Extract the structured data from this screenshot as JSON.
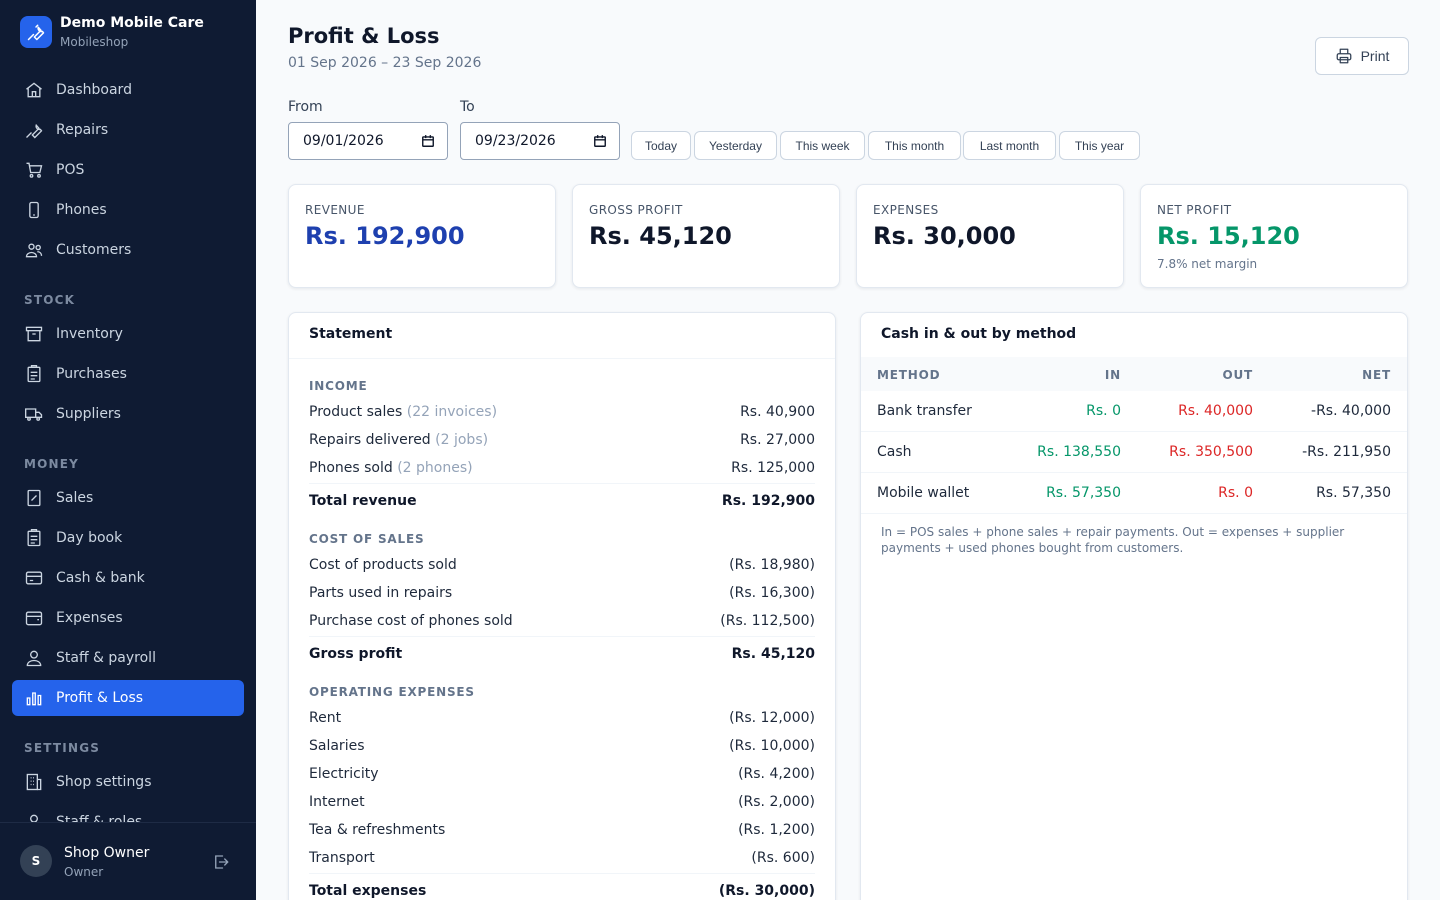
{
  "brand": {
    "title": "Demo Mobile Care",
    "subtitle": "Mobileshop"
  },
  "nav": {
    "main": [
      {
        "label": "Dashboard",
        "icon": "home-icon"
      },
      {
        "label": "Repairs",
        "icon": "wrench-icon"
      },
      {
        "label": "POS",
        "icon": "cart-icon"
      },
      {
        "label": "Phones",
        "icon": "phone-icon"
      },
      {
        "label": "Customers",
        "icon": "users-icon"
      }
    ],
    "stock_heading": "STOCK",
    "stock": [
      {
        "label": "Inventory",
        "icon": "archive-icon"
      },
      {
        "label": "Purchases",
        "icon": "clipboard-icon"
      },
      {
        "label": "Suppliers",
        "icon": "truck-icon"
      }
    ],
    "money_heading": "MONEY",
    "money": [
      {
        "label": "Sales",
        "icon": "receipt-icon"
      },
      {
        "label": "Day book",
        "icon": "book-icon"
      },
      {
        "label": "Cash & bank",
        "icon": "card-icon"
      },
      {
        "label": "Expenses",
        "icon": "wallet-icon"
      },
      {
        "label": "Staff & payroll",
        "icon": "person-icon"
      },
      {
        "label": "Profit & Loss",
        "icon": "bar-chart-icon",
        "active": true
      }
    ],
    "settings_heading": "SETTINGS",
    "settings": [
      {
        "label": "Shop settings",
        "icon": "building-icon"
      },
      {
        "label": "Staff & roles",
        "icon": "person-icon"
      }
    ]
  },
  "user": {
    "initial": "S",
    "name": "Shop Owner",
    "role": "Owner"
  },
  "header": {
    "title": "Profit & Loss",
    "range": "01 Sep 2026 – 23 Sep 2026",
    "print_label": "Print"
  },
  "filters": {
    "from_label": "From",
    "from_value": "09/01/2026",
    "to_label": "To",
    "to_value": "09/23/2026",
    "quick": [
      "Today",
      "Yesterday",
      "This week",
      "This month",
      "Last month",
      "This year"
    ]
  },
  "kpis": [
    {
      "label": "REVENUE",
      "value": "Rs. 192,900",
      "color": "#1e40af",
      "note": ""
    },
    {
      "label": "GROSS PROFIT",
      "value": "Rs. 45,120",
      "color": "#0f172a",
      "note": ""
    },
    {
      "label": "EXPENSES",
      "value": "Rs. 30,000",
      "color": "#0f172a",
      "note": ""
    },
    {
      "label": "NET PROFIT",
      "value": "Rs. 15,120",
      "color": "#059669",
      "note": "7.8% net margin"
    }
  ],
  "statement": {
    "title": "Statement",
    "income_heading": "INCOME",
    "income": [
      {
        "label": "Product sales",
        "detail": "(22 invoices)",
        "amount": "Rs. 40,900"
      },
      {
        "label": "Repairs delivered",
        "detail": "(2 jobs)",
        "amount": "Rs. 27,000"
      },
      {
        "label": "Phones sold",
        "detail": "(2 phones)",
        "amount": "Rs. 125,000"
      }
    ],
    "total_revenue_label": "Total revenue",
    "total_revenue": "Rs. 192,900",
    "cos_heading": "COST OF SALES",
    "cos": [
      {
        "label": "Cost of products sold",
        "amount": "(Rs. 18,980)"
      },
      {
        "label": "Parts used in repairs",
        "amount": "(Rs. 16,300)"
      },
      {
        "label": "Purchase cost of phones sold",
        "amount": "(Rs. 112,500)"
      }
    ],
    "gross_profit_label": "Gross profit",
    "gross_profit": "Rs. 45,120",
    "opex_heading": "OPERATING EXPENSES",
    "opex": [
      {
        "label": "Rent",
        "amount": "(Rs. 12,000)"
      },
      {
        "label": "Salaries",
        "amount": "(Rs. 10,000)"
      },
      {
        "label": "Electricity",
        "amount": "(Rs. 4,200)"
      },
      {
        "label": "Internet",
        "amount": "(Rs. 2,000)"
      },
      {
        "label": "Tea & refreshments",
        "amount": "(Rs. 1,200)"
      },
      {
        "label": "Transport",
        "amount": "(Rs. 600)"
      }
    ],
    "total_expenses_label": "Total expenses",
    "total_expenses": "(Rs. 30,000)"
  },
  "cashflow": {
    "title": "Cash in & out by method",
    "headers": [
      "METHOD",
      "IN",
      "OUT",
      "NET"
    ],
    "rows": [
      {
        "method": "Bank transfer",
        "in": "Rs. 0",
        "out": "Rs. 40,000",
        "net": "-Rs. 40,000"
      },
      {
        "method": "Cash",
        "in": "Rs. 138,550",
        "out": "Rs. 350,500",
        "net": "-Rs. 211,950"
      },
      {
        "method": "Mobile wallet",
        "in": "Rs. 57,350",
        "out": "Rs. 0",
        "net": "Rs. 57,350"
      }
    ],
    "note": "In = POS sales + phone sales + repair payments. Out = expenses + supplier payments + used phones bought from customers.",
    "in_color": "#059669",
    "out_color": "#dc2626"
  }
}
